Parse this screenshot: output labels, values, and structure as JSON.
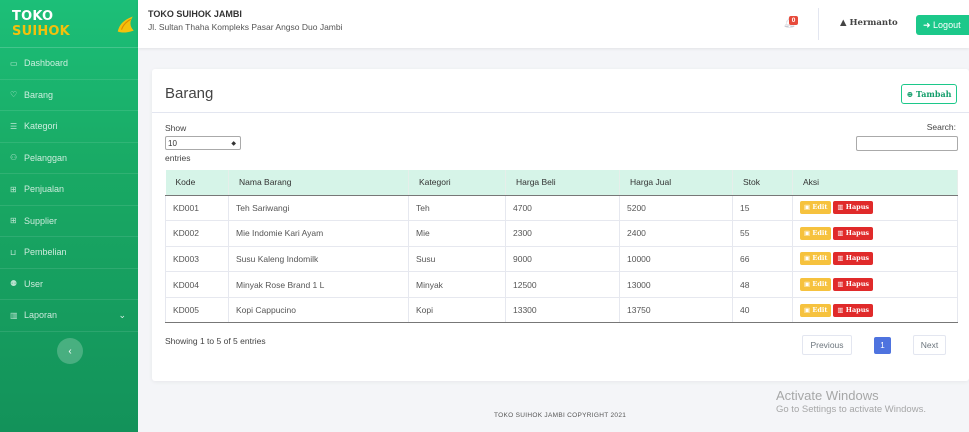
{
  "sidebar": {
    "brand_primary": "TOKO ",
    "brand_accent": "SUIHOK",
    "items": [
      {
        "label": "Dashboard",
        "icon": "monitor-icon"
      },
      {
        "label": "Barang",
        "icon": "shield-icon"
      },
      {
        "label": "Kategori",
        "icon": "list-icon"
      },
      {
        "label": "Pelanggan",
        "icon": "users-icon"
      },
      {
        "label": "Penjualan",
        "icon": "cart-icon"
      },
      {
        "label": "Supplier",
        "icon": "truck-icon"
      },
      {
        "label": "Pembelian",
        "icon": "basket-icon"
      },
      {
        "label": "User",
        "icon": "user-icon"
      },
      {
        "label": "Laporan",
        "icon": "report-icon",
        "has_chevron": true
      }
    ],
    "toggle_glyph": "‹"
  },
  "topbar": {
    "store_name": "TOKO SUIHOK JAMBI",
    "store_address": "Jl. Sultan Thaha Kompleks Pasar Angso Duo Jambi",
    "notif_count": "0",
    "user_name": "Hermanto",
    "logout_label": "Logout"
  },
  "page": {
    "title": "Barang",
    "add_label": "Tambah",
    "show_label": "Show",
    "page_length": "10",
    "entries_label": "entries",
    "search_label": "Search:",
    "showing_text": "Showing 1 to 5 of 5 entries",
    "pagination": {
      "previous": "Previous",
      "current": "1",
      "next": "Next"
    }
  },
  "table": {
    "headers": [
      "Kode",
      "Nama Barang",
      "Kategori",
      "Harga Beli",
      "Harga Jual",
      "Stok",
      "Aksi"
    ],
    "rows": [
      [
        "KD001",
        "Teh Sariwangi",
        "Teh",
        "4700",
        "5200",
        "15"
      ],
      [
        "KD002",
        "Mie Indomie Kari Ayam",
        "Mie",
        "2300",
        "2400",
        "55"
      ],
      [
        "KD003",
        "Susu Kaleng Indomilk",
        "Susu",
        "9000",
        "10000",
        "66"
      ],
      [
        "KD004",
        "Minyak Rose Brand 1 L",
        "Minyak",
        "12500",
        "13000",
        "48"
      ],
      [
        "KD005",
        "Kopi Cappucino",
        "Kopi",
        "13300",
        "13750",
        "40"
      ]
    ],
    "edit_label": "Edit",
    "delete_label": "Hapus"
  },
  "footer": {
    "copyright": "TOKO SUIHOK JAMBI COPYRIGHT 2021"
  },
  "watermark": {
    "title": "Activate Windows",
    "subtitle": "Go to Settings to activate Windows."
  },
  "colors": {
    "sidebar": "#19a964",
    "accent": "#1cc88a",
    "table_header": "#d6f4e8",
    "edit": "#f6c23e",
    "delete": "#e02a2a",
    "page_active": "#4e73df"
  }
}
